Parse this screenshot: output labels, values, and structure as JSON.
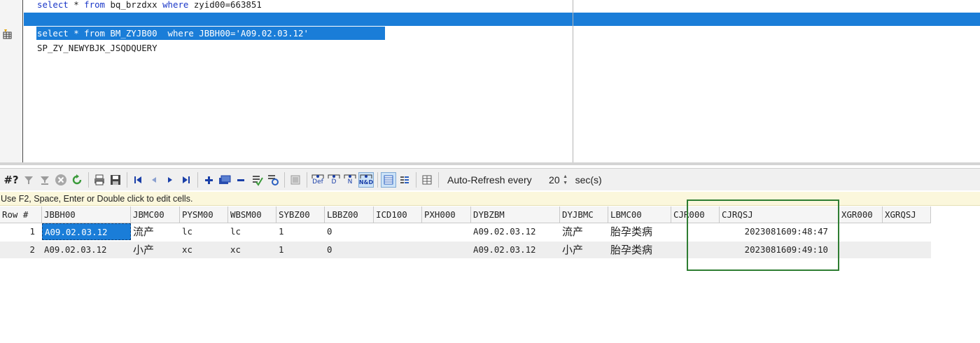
{
  "editor": {
    "lines": [
      {
        "kw1": "select",
        "plain1": " * ",
        "kw2": "from",
        "plain2": " bq_brzdxx ",
        "kw3": "where",
        "plain3": " zyid00=663851"
      },
      {
        "text": "select * from BM_ZYJB00  where JBBH00='A09.02.03.12'"
      },
      {
        "text": "SP_ZY_NEWYBJK_JSQDQUERY"
      }
    ]
  },
  "toolbar": {
    "record_label": "#?",
    "auto_refresh_label": "Auto-Refresh every",
    "refresh_value": "20",
    "sec_label": "sec(s)",
    "icons": [
      "filter-icon",
      "filter-clear-icon",
      "cancel-icon",
      "refresh-icon",
      "print-icon",
      "save-icon",
      "first-record-icon",
      "prev-record-icon",
      "next-record-icon",
      "last-record-icon",
      "add-row-icon",
      "duplicate-row-icon",
      "delete-row-icon",
      "post-icon",
      "refresh-data-icon",
      "blob-icon",
      "default-icon",
      "d-icon",
      "n-icon",
      "nd-icon",
      "grid-view-icon",
      "form-view-icon",
      "columns-icon"
    ],
    "labels": {
      "def": "Def",
      "d": "D",
      "n": "N",
      "nd": "N&D"
    }
  },
  "hint": "Use F2, Space, Enter or Double click to edit cells.",
  "grid": {
    "columns": [
      "Row #",
      "JBBH00",
      "JBMC00",
      "PYSM00",
      "WBSM00",
      "SYBZ00",
      "LBBZ00",
      "ICD100",
      "PXH000",
      "DYBZBM",
      "DYJBMC",
      "LBMC00",
      "CJR000",
      "CJRQSJ",
      "XGR000",
      "XGRQSJ"
    ],
    "rows": [
      [
        "1",
        "A09.02.03.12",
        "流产",
        "lc",
        "lc",
        "1",
        "0",
        "",
        "",
        "A09.02.03.12",
        "流产",
        "胎孕类病",
        "",
        "2023081609:48:47",
        "",
        ""
      ],
      [
        "2",
        "A09.02.03.12",
        "小产",
        "xc",
        "xc",
        "1",
        "0",
        "",
        "",
        "A09.02.03.12",
        "小产",
        "胎孕类病",
        "",
        "2023081609:49:10",
        "",
        ""
      ]
    ]
  },
  "colors": {
    "selection": "#1a7dd8",
    "keyword": "#1a37c8",
    "highlight_box": "#2e7d32"
  }
}
